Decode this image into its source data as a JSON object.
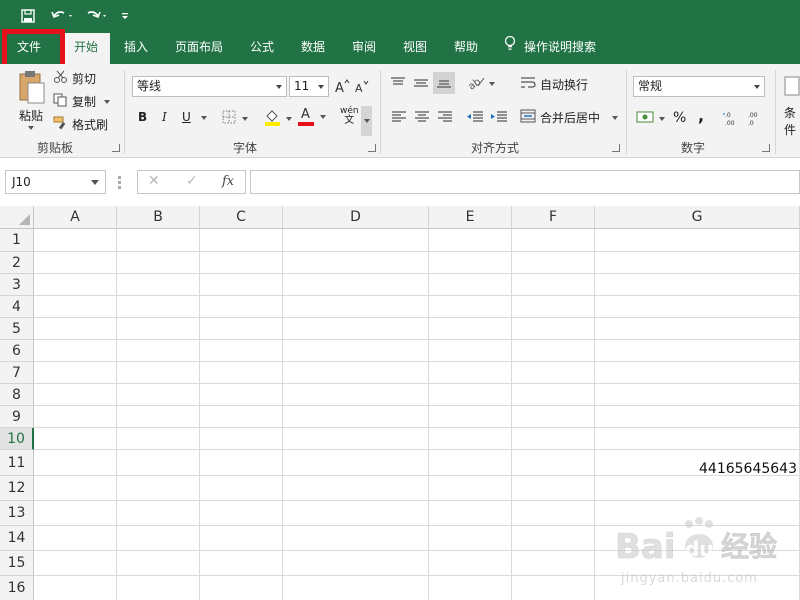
{
  "quick_access": {
    "save_icon": "save-icon",
    "undo_icon": "undo-icon",
    "redo_icon": "redo-icon",
    "customize_icon": "customize-quick-access-icon"
  },
  "tabs": [
    {
      "label": "文件"
    },
    {
      "label": "开始"
    },
    {
      "label": "插入"
    },
    {
      "label": "页面布局"
    },
    {
      "label": "公式"
    },
    {
      "label": "数据"
    },
    {
      "label": "审阅"
    },
    {
      "label": "视图"
    },
    {
      "label": "帮助"
    }
  ],
  "tell_me": "操作说明搜索",
  "ribbon": {
    "clipboard": {
      "paste": "粘贴",
      "cut": "剪切",
      "copy": "复制",
      "format_painter": "格式刷",
      "label": "剪贴板"
    },
    "font": {
      "font_name": "等线",
      "font_size": "11",
      "bold": "B",
      "italic": "I",
      "underline": "U",
      "font_color_letter": "A",
      "phonetic_top": "wén",
      "phonetic_bottom": "文",
      "label": "字体"
    },
    "alignment": {
      "wrap_text": "自动换行",
      "merge_center": "合并后居中",
      "label": "对齐方式"
    },
    "number": {
      "format": "常规",
      "percent": "%",
      "comma": ",",
      "label": "数字"
    },
    "styles": {
      "conditional_partial": "条件"
    }
  },
  "formula_bar": {
    "name_box": "J10",
    "cancel": "✕",
    "enter": "✓",
    "fx": "fx",
    "content": ""
  },
  "grid": {
    "columns": [
      "A",
      "B",
      "C",
      "D",
      "E",
      "F",
      "G"
    ],
    "rows": [
      "1",
      "2",
      "3",
      "4",
      "5",
      "6",
      "7",
      "8",
      "9",
      "10",
      "11",
      "12",
      "13",
      "14",
      "15",
      "16"
    ],
    "selected_row": "10",
    "cell_G11": "44165645643"
  },
  "watermark": {
    "brand": "Bai",
    "brand2": "du",
    "cn": "经验",
    "url": "jingyan.baidu.com"
  },
  "colors": {
    "excel_green": "#217346",
    "highlight_red": "#e5101a"
  }
}
